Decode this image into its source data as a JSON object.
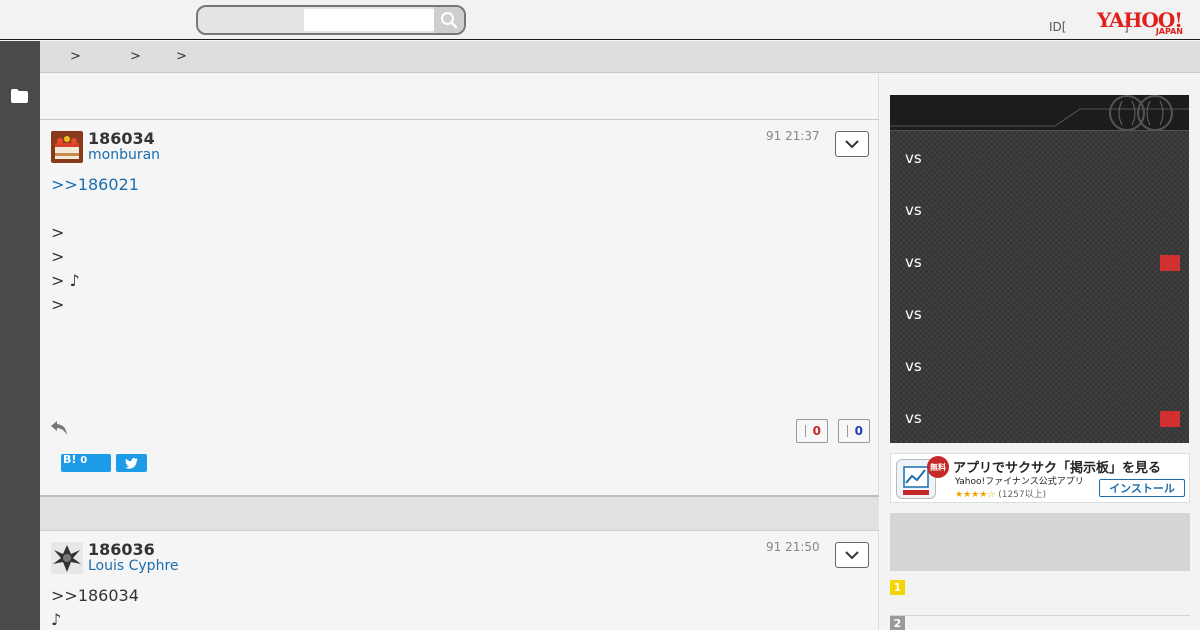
{
  "header": {
    "search_placeholder": "",
    "login_text": "ID[",
    "login_bracket": "]",
    "logo_main": "YAHOO!",
    "logo_sub": "JAPAN"
  },
  "breadcrumb": {
    "separators": [
      ">",
      ">",
      ">"
    ]
  },
  "posts": [
    {
      "number": "186034",
      "user": "monburan",
      "date": "91 21:37",
      "reply_ref": ">>186021",
      "lines": [
        ">",
        ">",
        "> ♪",
        ">"
      ],
      "likes": "0",
      "dislikes": "0",
      "hatena_label": "B!",
      "hatena_count": "0",
      "avatar_icon": "cake-avatar"
    },
    {
      "number": "186036",
      "user": "Louis Cyphre",
      "date": "91 21:50",
      "lines": [
        ">>186034",
        "♪"
      ],
      "avatar_icon": "figure-avatar"
    }
  ],
  "sidebar": {
    "scores": [
      {
        "label": "vs",
        "flag": false
      },
      {
        "label": "vs",
        "flag": false
      },
      {
        "label": "vs",
        "flag": true
      },
      {
        "label": "vs",
        "flag": false
      },
      {
        "label": "vs",
        "flag": false
      },
      {
        "label": "vs",
        "flag": true
      }
    ],
    "app_banner": {
      "badge": "無料",
      "title": "アプリでサクサク「掲示板」を見る",
      "subtitle": "Yahoo!ファイナンス公式アプリ",
      "stars": "★★★★☆",
      "count": "(1257以上)",
      "install_label": "インストール"
    },
    "ranking": [
      "1",
      "2"
    ]
  },
  "colors": {
    "accent_red": "#e0201b",
    "link_blue": "#1a6dae",
    "hatena_blue": "#1e9be6",
    "rank1": "#f5d400",
    "rank2": "#9a9a9a"
  }
}
